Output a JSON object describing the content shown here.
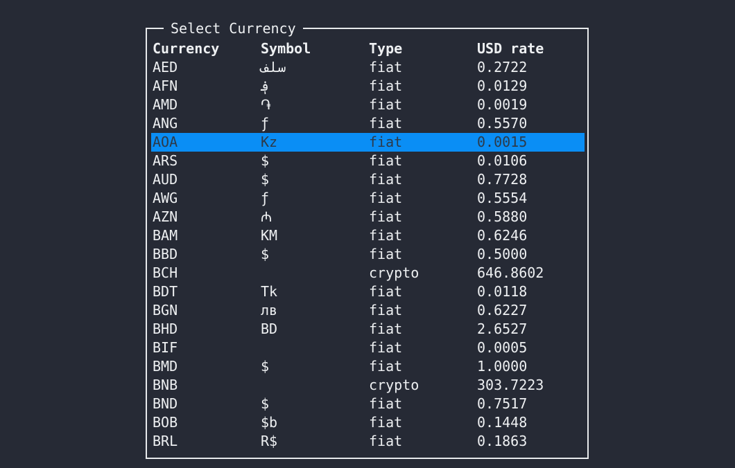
{
  "dialog": {
    "title": "Select Currency"
  },
  "table": {
    "headers": [
      "Currency",
      "Symbol",
      "Type",
      "USD rate"
    ],
    "selected_index": 4,
    "rows": [
      [
        "AED",
        "سلف",
        "fiat",
        "0.2722"
      ],
      [
        "AFN",
        "؋",
        "fiat",
        "0.0129"
      ],
      [
        "AMD",
        "֏",
        "fiat",
        "0.0019"
      ],
      [
        "ANG",
        "ƒ",
        "fiat",
        "0.5570"
      ],
      [
        "AOA",
        "Kz",
        "fiat",
        "0.0015"
      ],
      [
        "ARS",
        "$",
        "fiat",
        "0.0106"
      ],
      [
        "AUD",
        "$",
        "fiat",
        "0.7728"
      ],
      [
        "AWG",
        "ƒ",
        "fiat",
        "0.5554"
      ],
      [
        "AZN",
        "₼",
        "fiat",
        "0.5880"
      ],
      [
        "BAM",
        "KM",
        "fiat",
        "0.6246"
      ],
      [
        "BBD",
        "$",
        "fiat",
        "0.5000"
      ],
      [
        "BCH",
        "",
        "crypto",
        "646.8602"
      ],
      [
        "BDT",
        "Tk",
        "fiat",
        "0.0118"
      ],
      [
        "BGN",
        "лв",
        "fiat",
        "0.6227"
      ],
      [
        "BHD",
        "BD",
        "fiat",
        "2.6527"
      ],
      [
        "BIF",
        "",
        "fiat",
        "0.0005"
      ],
      [
        "BMD",
        "$",
        "fiat",
        "1.0000"
      ],
      [
        "BNB",
        "",
        "crypto",
        "303.7223"
      ],
      [
        "BND",
        "$",
        "fiat",
        "0.7517"
      ],
      [
        "BOB",
        "$b",
        "fiat",
        "0.1448"
      ],
      [
        "BRL",
        "R$",
        "fiat",
        "0.1863"
      ]
    ]
  },
  "colors": {
    "background": "#262a35",
    "foreground": "#eef0f2",
    "border": "#e8eaec",
    "selection_background": "#0a8ef5",
    "selection_foreground": "#2c3a4a"
  }
}
